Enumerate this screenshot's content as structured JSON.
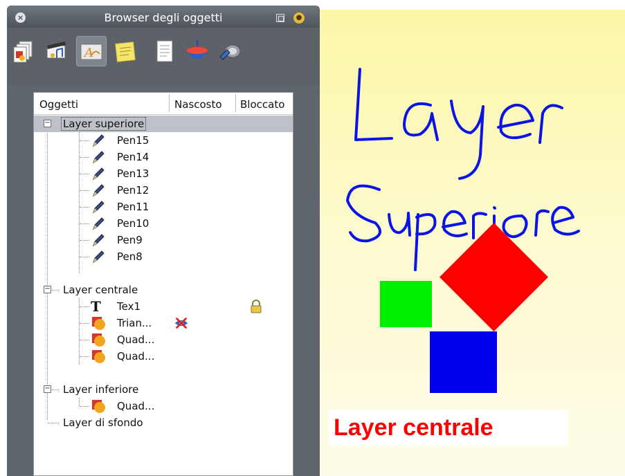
{
  "panel": {
    "title": "Browser degli oggetti",
    "close_icon": "close-icon",
    "restore_icon": "restore-icon",
    "pin_icon": "pin-icon"
  },
  "toolbar": {
    "buttons": [
      {
        "icon": "pages-icon"
      },
      {
        "icon": "media-icon"
      },
      {
        "icon": "text-object-icon",
        "active": true
      },
      {
        "icon": "notes-icon"
      },
      {
        "icon": "document-icon"
      },
      {
        "icon": "spinning-top-icon"
      },
      {
        "icon": "tool-icon"
      }
    ]
  },
  "table": {
    "headers": {
      "objects": "Oggetti",
      "hidden": "Nascosto",
      "locked": "Bloccato"
    }
  },
  "tree": {
    "layer_top": {
      "label": "Layer superiore",
      "items": [
        "Pen15",
        "Pen14",
        "Pen13",
        "Pen12",
        "Pen11",
        "Pen10",
        "Pen9",
        "Pen8"
      ]
    },
    "layer_middle": {
      "label": "Layer centrale",
      "items": [
        "Tex1",
        "Trian...",
        "Quad...",
        "Quad..."
      ]
    },
    "layer_bottom": {
      "label": "Layer inferiore",
      "items": [
        "Quad..."
      ]
    },
    "layer_background": {
      "label": "Layer di sfondo"
    }
  },
  "canvas": {
    "centrale_text": "Layer centrale",
    "colors": {
      "handwriting": "#0a14e6",
      "red_shape": "#ff0000",
      "green_shape": "#00ee00",
      "blue_shape": "#0000ee",
      "centrale_text": "#ff0000"
    }
  }
}
